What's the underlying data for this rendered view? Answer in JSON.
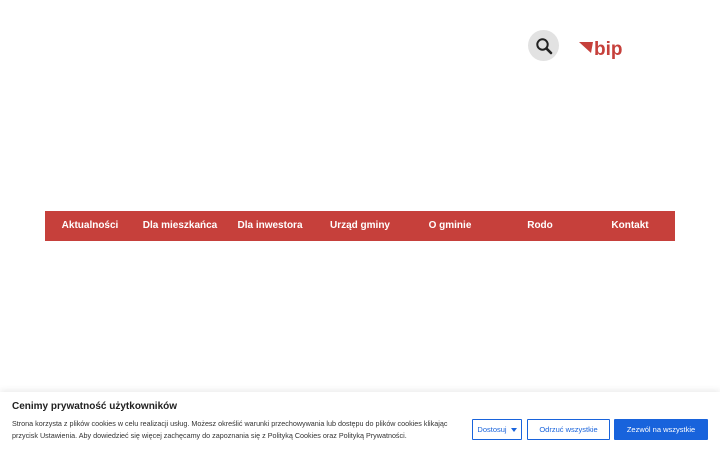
{
  "header": {
    "search_icon": "search-icon",
    "logo_text": "bip",
    "logo_color": "#c6403b"
  },
  "nav": {
    "background": "#c6403b",
    "items": [
      {
        "label": "Aktualności"
      },
      {
        "label": "Dla mieszkańca"
      },
      {
        "label": "Dla inwestora"
      },
      {
        "label": "Urząd gminy"
      },
      {
        "label": "O gminie"
      },
      {
        "label": "Rodo"
      },
      {
        "label": "Kontakt"
      }
    ]
  },
  "cookie": {
    "title": "Cenimy prywatność użytkowników",
    "text_line1": "Strona korzysta z plików cookies w celu realizacji usług. Możesz określić warunki przechowywania lub dostępu do plików cookies klikając",
    "text_line2_a": "przycisk Ustawienia. Aby dowiedzieć się więcej zachęcamy do zapoznania się z ",
    "policy_cookies": "Polityką Cookies",
    "text_oraz": " oraz ",
    "policy_privacy": "Polityką Prywatności",
    "text_end": ".",
    "customize_label": "Dostosuj",
    "reject_label": "Odrzuć wszystkie",
    "accept_label": "Zezwól na wszystkie",
    "accent_color": "#1863dc"
  }
}
